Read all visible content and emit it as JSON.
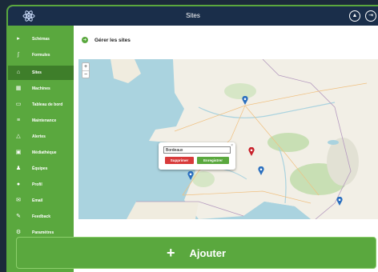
{
  "header": {
    "title": "Sites"
  },
  "sidebar": {
    "items": [
      {
        "label": "Schémas",
        "icon": "flow-icon",
        "active": false
      },
      {
        "label": "Formules",
        "icon": "formula-icon",
        "active": false
      },
      {
        "label": "Sites",
        "icon": "location-icon",
        "active": true
      },
      {
        "label": "Machines",
        "icon": "machine-icon",
        "active": false
      },
      {
        "label": "Tableau de bord",
        "icon": "dashboard-icon",
        "active": false
      },
      {
        "label": "Maintenance",
        "icon": "maintenance-icon",
        "active": false
      },
      {
        "label": "Alertes",
        "icon": "alert-icon",
        "active": false
      },
      {
        "label": "Médiathèque",
        "icon": "media-icon",
        "active": false
      },
      {
        "label": "Équipes",
        "icon": "team-icon",
        "active": false
      },
      {
        "label": "Profil",
        "icon": "user-icon",
        "active": false
      },
      {
        "label": "Email",
        "icon": "email-icon",
        "active": false
      },
      {
        "label": "Feedback",
        "icon": "feedback-icon",
        "active": false
      },
      {
        "label": "Paramètres",
        "icon": "gear-icon",
        "active": false
      }
    ]
  },
  "main": {
    "title": "Gérer les sites"
  },
  "map": {
    "zoom_in": "+",
    "zoom_out": "−",
    "popup": {
      "input_value": "Bordeaux",
      "delete_label": "Supprimer",
      "save_label": "Enregistrer",
      "close": "×"
    }
  },
  "footer": {
    "add_label": "Ajouter",
    "add_icon": "+"
  },
  "colors": {
    "accent": "#5aa83e",
    "topbar": "#1a2e4a",
    "danger": "#d83a3a",
    "pin_blue": "#2a6fbf",
    "pin_red": "#c8202a"
  }
}
